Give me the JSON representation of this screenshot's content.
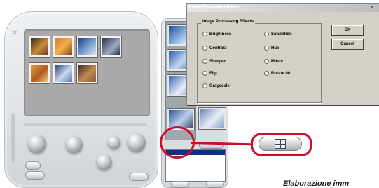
{
  "dialog": {
    "title": "Image Processing Dialog",
    "close_glyph": "×",
    "group_label": "Image Processing Effects",
    "effects_left": [
      "Brightness",
      "Contrast",
      "Sharpen",
      "Flip",
      "Grayscale"
    ],
    "effects_right": [
      "Saturation",
      "Hue",
      "Mirror",
      "Rotate 90"
    ],
    "ok_label": "OK",
    "cancel_label": "Cancel"
  },
  "callout": {
    "caption": "Elaborazione imm"
  },
  "colors": {
    "callout_red": "#c8102e",
    "dialog_bg": "#d4d0c8",
    "list_highlight": "#0a2e8a"
  },
  "icons": [
    "grid-view-icon",
    "close-icon"
  ]
}
